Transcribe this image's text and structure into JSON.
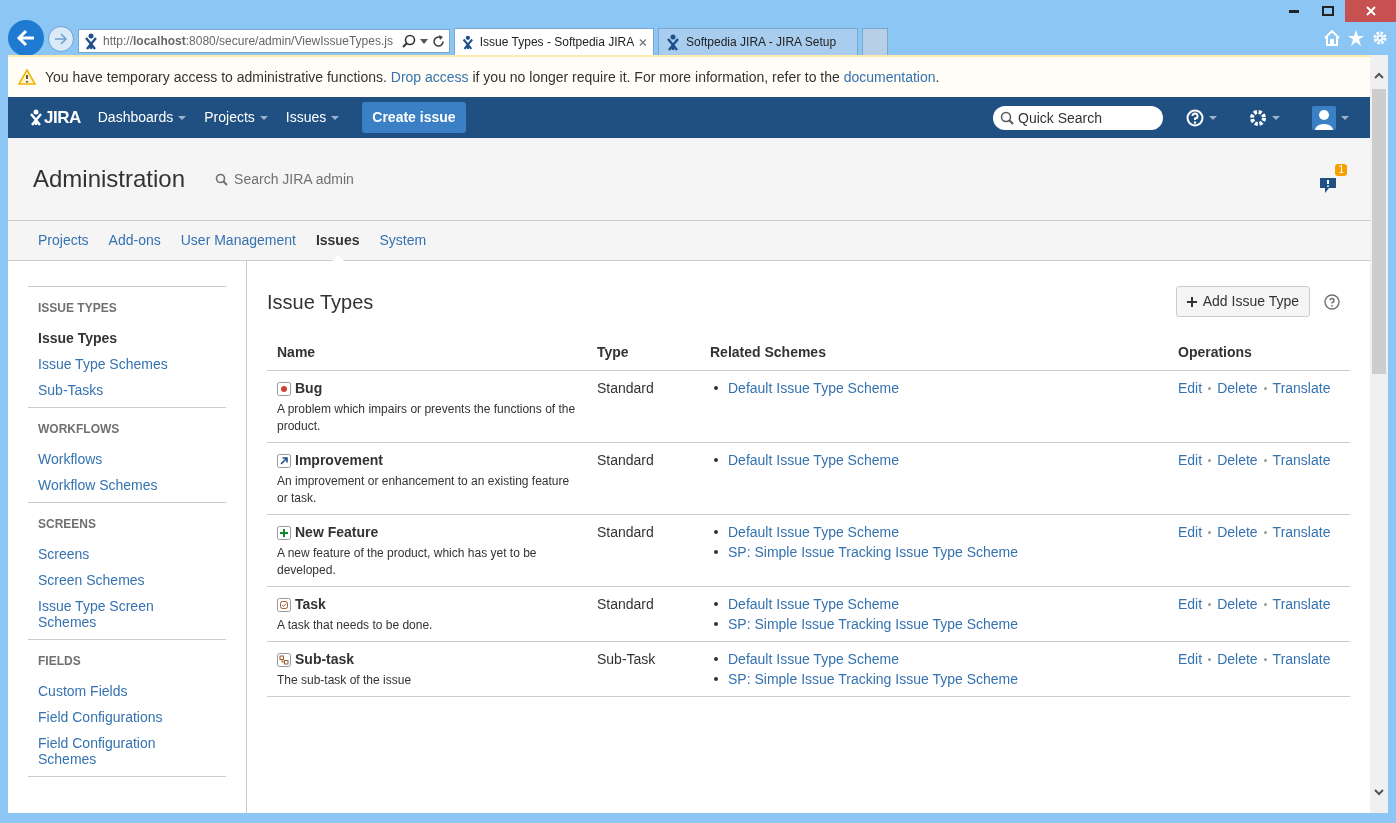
{
  "browser": {
    "address": "http://**localhost**:8080/secure/admin/ViewIssueTypes.js",
    "tabs": [
      {
        "title": "Issue Types - Softpedia JIRA",
        "selected": true
      },
      {
        "title": "Softpedia JIRA - JIRA Setup",
        "selected": false
      }
    ]
  },
  "banner": [
    {
      "text": "You have temporary access to administrative functions. ",
      "link": false
    },
    {
      "text": "Drop access",
      "link": true
    },
    {
      "text": " if you no longer require it. For more information, refer to the ",
      "link": false
    },
    {
      "text": "documentation",
      "link": true
    },
    {
      "text": ".",
      "link": false
    }
  ],
  "header": {
    "logo": "JIRA",
    "menus": [
      "Dashboards",
      "Projects",
      "Issues"
    ],
    "create_button": "Create issue",
    "search_placeholder": "Quick Search"
  },
  "admin": {
    "title": "Administration",
    "search_placeholder": "Search JIRA admin",
    "notification_count": "1"
  },
  "admin_tabs": [
    {
      "label": "Projects",
      "selected": false
    },
    {
      "label": "Add-ons",
      "selected": false
    },
    {
      "label": "User Management",
      "selected": false
    },
    {
      "label": "Issues",
      "selected": true
    },
    {
      "label": "System",
      "selected": false
    }
  ],
  "sidebar": [
    {
      "heading": "ISSUE TYPES",
      "items": [
        {
          "label": "Issue Types",
          "selected": true
        },
        {
          "label": "Issue Type Schemes",
          "selected": false
        },
        {
          "label": "Sub-Tasks",
          "selected": false
        }
      ]
    },
    {
      "heading": "WORKFLOWS",
      "items": [
        {
          "label": "Workflows",
          "selected": false
        },
        {
          "label": "Workflow Schemes",
          "selected": false
        }
      ]
    },
    {
      "heading": "SCREENS",
      "items": [
        {
          "label": "Screens",
          "selected": false
        },
        {
          "label": "Screen Schemes",
          "selected": false
        },
        {
          "label": "Issue Type Screen Schemes",
          "selected": false
        }
      ]
    },
    {
      "heading": "FIELDS",
      "items": [
        {
          "label": "Custom Fields",
          "selected": false
        },
        {
          "label": "Field Configurations",
          "selected": false
        },
        {
          "label": "Field Configuration Schemes",
          "selected": false
        }
      ]
    }
  ],
  "main": {
    "title": "Issue Types",
    "add_button": "Add Issue Type",
    "table": {
      "columns": [
        "Name",
        "Type",
        "Related Schemes",
        "Operations"
      ],
      "rows": [
        {
          "kind": "bug",
          "name": "Bug",
          "description": "A problem which impairs or prevents the functions of the product.",
          "type": "Standard",
          "schemes": [
            "Default Issue Type Scheme"
          ],
          "operations": [
            "Edit",
            "Delete",
            "Translate"
          ]
        },
        {
          "kind": "improvement",
          "name": "Improvement",
          "description": "An improvement or enhancement to an existing feature or task.",
          "type": "Standard",
          "schemes": [
            "Default Issue Type Scheme"
          ],
          "operations": [
            "Edit",
            "Delete",
            "Translate"
          ]
        },
        {
          "kind": "new-feature",
          "name": "New Feature",
          "description": "A new feature of the product, which has yet to be developed.",
          "type": "Standard",
          "schemes": [
            "Default Issue Type Scheme",
            "SP: Simple Issue Tracking Issue Type Scheme"
          ],
          "operations": [
            "Edit",
            "Delete",
            "Translate"
          ]
        },
        {
          "kind": "task",
          "name": "Task",
          "description": "A task that needs to be done.",
          "type": "Standard",
          "schemes": [
            "Default Issue Type Scheme",
            "SP: Simple Issue Tracking Issue Type Scheme"
          ],
          "operations": [
            "Edit",
            "Delete",
            "Translate"
          ]
        },
        {
          "kind": "subtask",
          "name": "Sub-task",
          "description": "The sub-task of the issue",
          "type": "Sub-Task",
          "schemes": [
            "Default Issue Type Scheme",
            "SP: Simple Issue Tracking Issue Type Scheme"
          ],
          "operations": [
            "Edit",
            "Delete",
            "Translate"
          ]
        }
      ]
    }
  }
}
